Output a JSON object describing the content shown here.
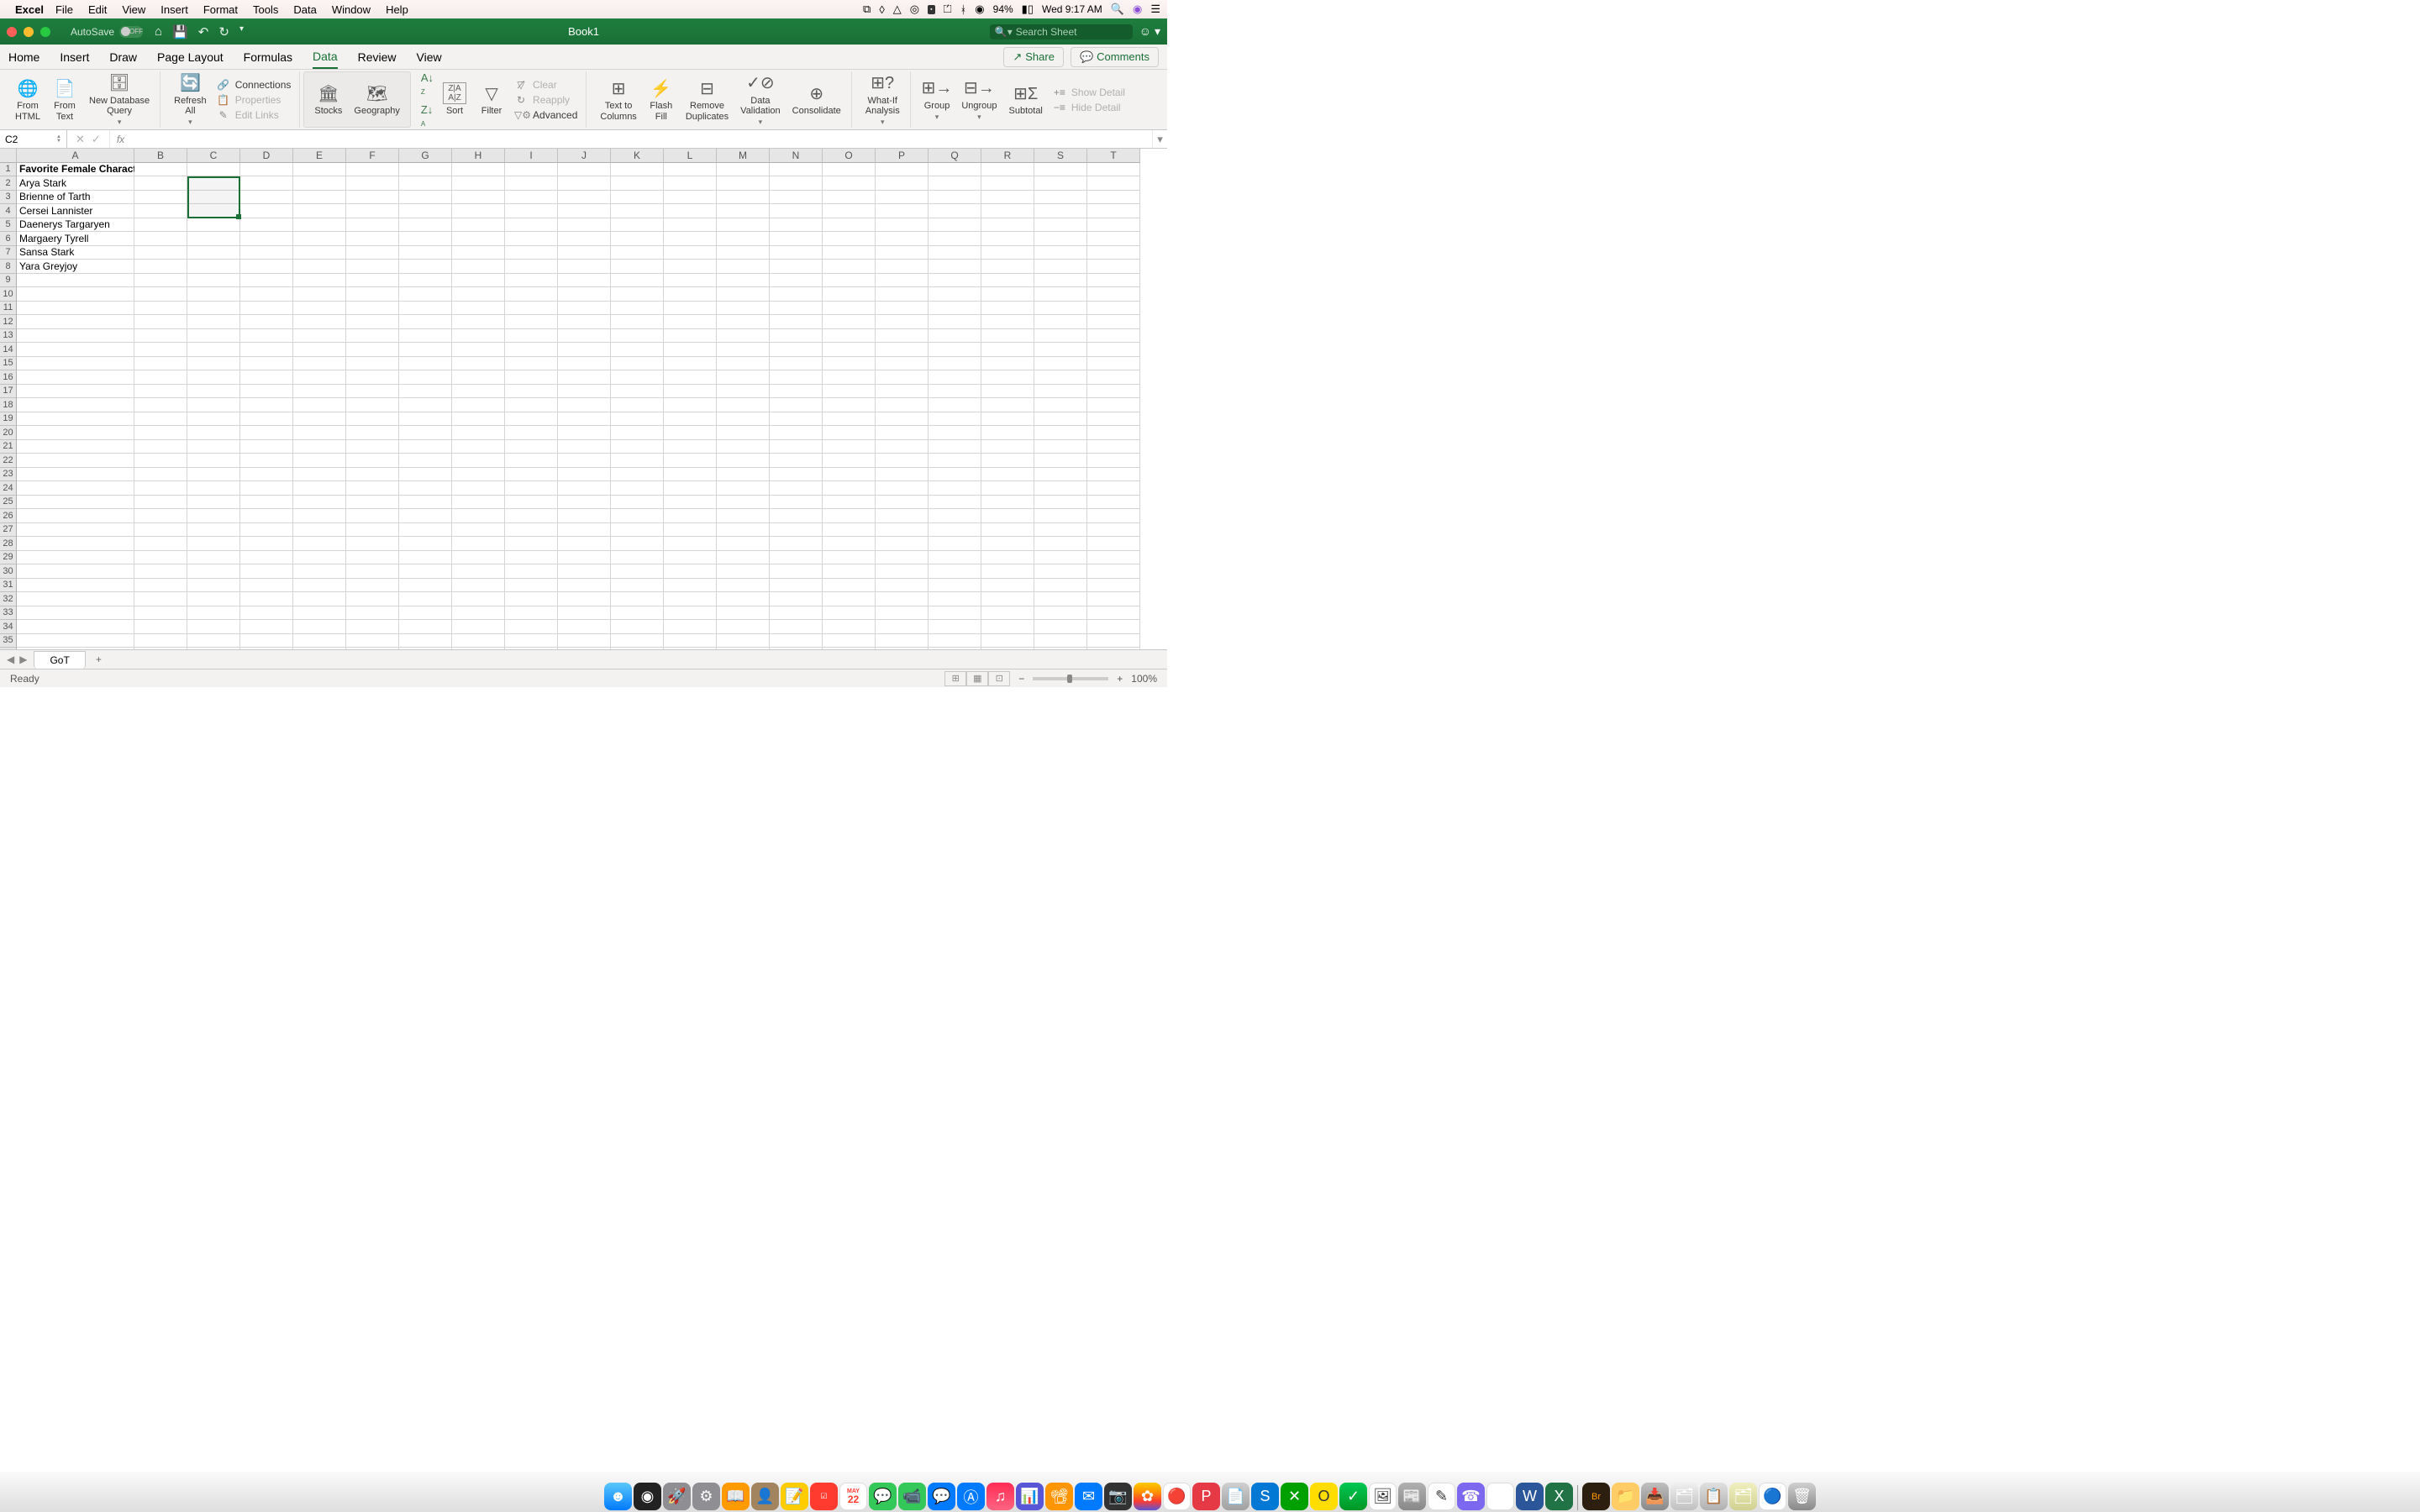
{
  "menubar": {
    "app": "Excel",
    "items": [
      "File",
      "Edit",
      "View",
      "Insert",
      "Format",
      "Tools",
      "Data",
      "Window",
      "Help"
    ],
    "battery": "94%",
    "datetime": "Wed 9:17 AM"
  },
  "titlebar": {
    "autosave_label": "AutoSave",
    "autosave_state": "OFF",
    "title": "Book1",
    "search_placeholder": "Search Sheet"
  },
  "ribbon_tabs": [
    "Home",
    "Insert",
    "Draw",
    "Page Layout",
    "Formulas",
    "Data",
    "Review",
    "View"
  ],
  "active_tab": "Data",
  "share_label": "Share",
  "comments_label": "Comments",
  "ribbon": {
    "from_html": "From\nHTML",
    "from_text": "From\nText",
    "new_db_query": "New Database\nQuery",
    "refresh_all": "Refresh\nAll",
    "connections": "Connections",
    "properties": "Properties",
    "edit_links": "Edit Links",
    "stocks": "Stocks",
    "geography": "Geography",
    "sort": "Sort",
    "filter": "Filter",
    "clear": "Clear",
    "reapply": "Reapply",
    "advanced": "Advanced",
    "text_to_columns": "Text to\nColumns",
    "flash_fill": "Flash\nFill",
    "remove_duplicates": "Remove\nDuplicates",
    "data_validation": "Data\nValidation",
    "consolidate": "Consolidate",
    "what_if": "What-If\nAnalysis",
    "group": "Group",
    "ungroup": "Ungroup",
    "subtotal": "Subtotal",
    "show_detail": "Show Detail",
    "hide_detail": "Hide Detail"
  },
  "name_box": "C2",
  "columns": [
    "A",
    "B",
    "C",
    "D",
    "E",
    "F",
    "G",
    "H",
    "I",
    "J",
    "K",
    "L",
    "M",
    "N",
    "O",
    "P",
    "Q",
    "R",
    "S",
    "T"
  ],
  "row_count": 37,
  "cells": {
    "A1": "Favorite Female Characters",
    "A2": "Arya Stark",
    "A3": "Brienne of Tarth",
    "A4": "Cersei Lannister",
    "A5": "Daenerys Targaryen",
    "A6": "Margaery Tyrell",
    "A7": "Sansa Stark",
    "A8": "Yara Greyjoy"
  },
  "bold_cells": [
    "A1"
  ],
  "selection": {
    "start": "C2",
    "end": "C4"
  },
  "sheet_tabs": [
    "GoT"
  ],
  "status": "Ready",
  "zoom": "100%",
  "calendar_day": "22"
}
